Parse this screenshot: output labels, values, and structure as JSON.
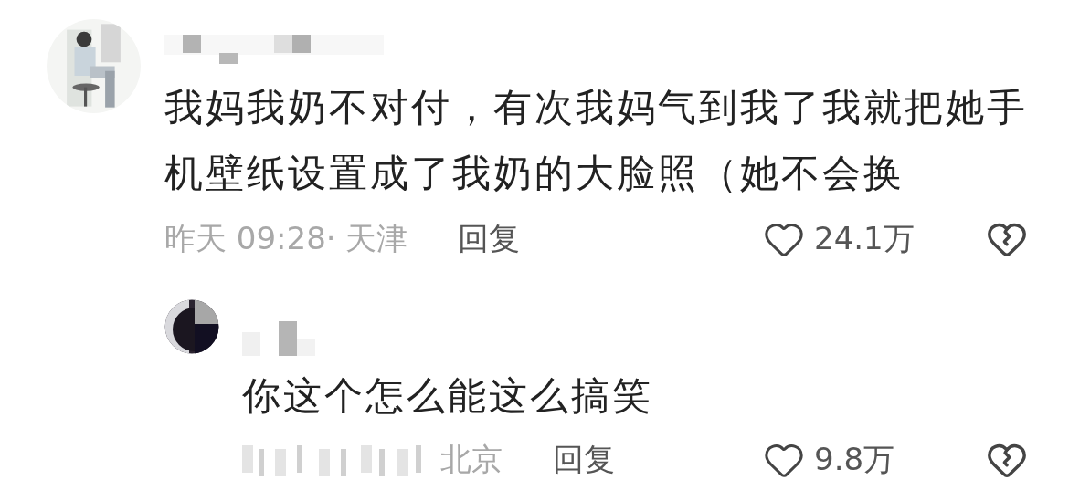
{
  "comments": [
    {
      "name_hidden": true,
      "text": "我妈我奶不对付，有次我妈气到我了我就把她手机壁纸设置成了我奶的大脸照（她不会换",
      "time": "昨天 09:28· 天津",
      "time_hidden": false,
      "reply_label": "回复",
      "likes": "24.1万",
      "replies": [
        {
          "name_hidden": true,
          "text": "你这个怎么能这么搞笑",
          "time": "北京",
          "time_hidden": true,
          "reply_label": "回复",
          "likes": "9.8万"
        }
      ]
    }
  ]
}
